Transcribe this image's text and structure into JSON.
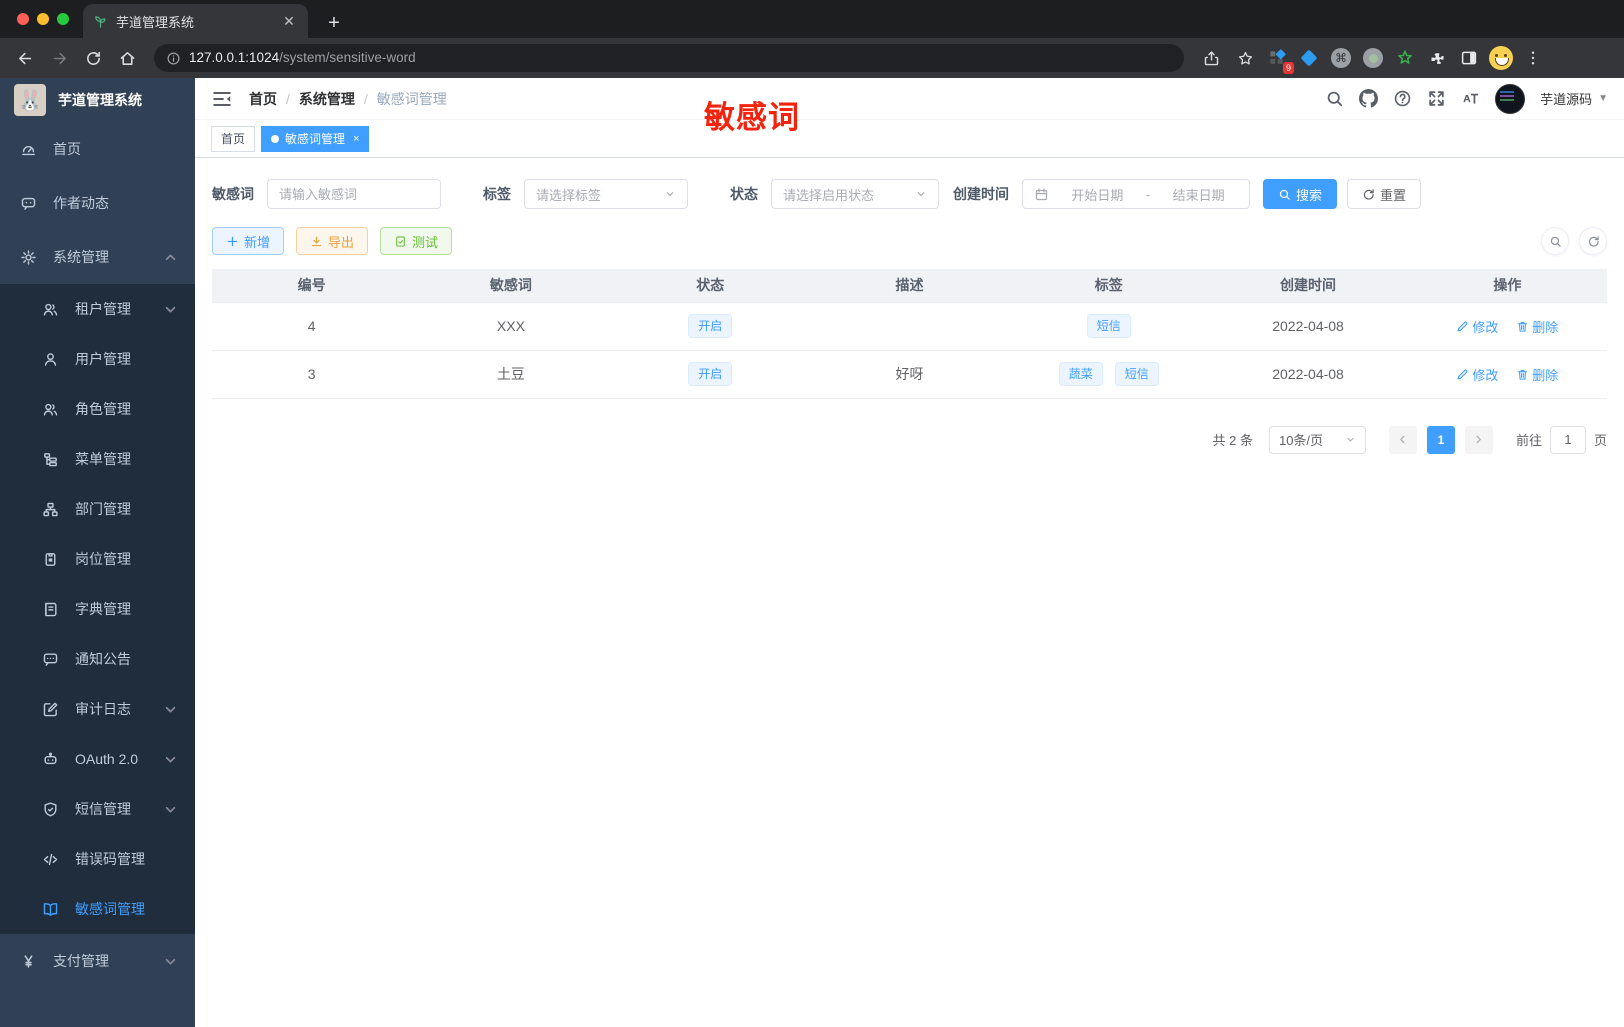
{
  "colors": {
    "accent": "#409eff",
    "warning": "#e6a23c",
    "success": "#67c23a",
    "annotation_red": "#f4230d",
    "sidebar_bg": "#304156",
    "submenu_bg": "#1f2d3d"
  },
  "browser": {
    "tab_title": "芋道管理系统",
    "favicon": "sprout-leaf-icon",
    "url_host": "127.0.0.1:1024",
    "url_path": "/system/sensitive-word",
    "extension_badge": "9"
  },
  "sidebar": {
    "title": "芋道管理系统",
    "items": [
      {
        "label": "首页",
        "icon": "dashboard-icon",
        "level": "top"
      },
      {
        "label": "作者动态",
        "icon": "author-chat-icon",
        "level": "top"
      },
      {
        "label": "系统管理",
        "icon": "gear-icon",
        "level": "top",
        "chevron": "up"
      },
      {
        "label": "租户管理",
        "icon": "tenant-users-icon",
        "level": "sub",
        "chevron": "down"
      },
      {
        "label": "用户管理",
        "icon": "user-icon",
        "level": "sub"
      },
      {
        "label": "角色管理",
        "icon": "role-users-icon",
        "level": "sub"
      },
      {
        "label": "菜单管理",
        "icon": "menu-tree-icon",
        "level": "sub"
      },
      {
        "label": "部门管理",
        "icon": "dept-sitemap-icon",
        "level": "sub"
      },
      {
        "label": "岗位管理",
        "icon": "post-badge-icon",
        "level": "sub"
      },
      {
        "label": "字典管理",
        "icon": "dict-book-icon",
        "level": "sub"
      },
      {
        "label": "通知公告",
        "icon": "notice-comment-icon",
        "level": "sub"
      },
      {
        "label": "审计日志",
        "icon": "audit-edit-icon",
        "level": "sub",
        "chevron": "down"
      },
      {
        "label": "OAuth 2.0",
        "icon": "oauth-robot-icon",
        "level": "sub",
        "chevron": "down"
      },
      {
        "label": "短信管理",
        "icon": "sms-shield-icon",
        "level": "sub",
        "chevron": "down"
      },
      {
        "label": "错误码管理",
        "icon": "errorcode-icon",
        "level": "sub"
      },
      {
        "label": "敏感词管理",
        "icon": "sensitive-book-icon",
        "level": "sub",
        "active": true
      },
      {
        "label": "支付管理",
        "icon": "pay-yen-icon",
        "level": "top",
        "chevron": "down"
      }
    ]
  },
  "header": {
    "breadcrumb": [
      "首页",
      "系统管理",
      "敏感词管理"
    ],
    "annotation": "敏感词",
    "user_name": "芋道源码"
  },
  "tabs": [
    {
      "label": "首页",
      "active": false
    },
    {
      "label": "敏感词管理",
      "active": true,
      "close": "×"
    }
  ],
  "filters": {
    "word_label": "敏感词",
    "word_placeholder": "请输入敏感词",
    "tag_label": "标签",
    "tag_placeholder": "请选择标签",
    "status_label": "状态",
    "status_placeholder": "请选择启用状态",
    "time_label": "创建时间",
    "start_placeholder": "开始日期",
    "range_dash": "-",
    "end_placeholder": "结束日期",
    "search_label": "搜索",
    "reset_label": "重置"
  },
  "toolbar": {
    "add_label": "新增",
    "export_label": "导出",
    "test_label": "测试"
  },
  "table": {
    "columns": [
      "编号",
      "敏感词",
      "状态",
      "描述",
      "标签",
      "创建时间",
      "操作"
    ],
    "rows": [
      {
        "id": "4",
        "word": "XXX",
        "status": "开启",
        "desc": "",
        "tags": [
          "短信"
        ],
        "date": "2022-04-08",
        "edit": "修改",
        "delete": "删除"
      },
      {
        "id": "3",
        "word": "土豆",
        "status": "开启",
        "desc": "好呀",
        "tags": [
          "蔬菜",
          "短信"
        ],
        "date": "2022-04-08",
        "edit": "修改",
        "delete": "删除"
      }
    ]
  },
  "pagination": {
    "total_text": "共 2 条",
    "page_size": "10条/页",
    "current_page": "1",
    "goto_label": "前往",
    "goto_value": "1",
    "page_unit": "页"
  }
}
